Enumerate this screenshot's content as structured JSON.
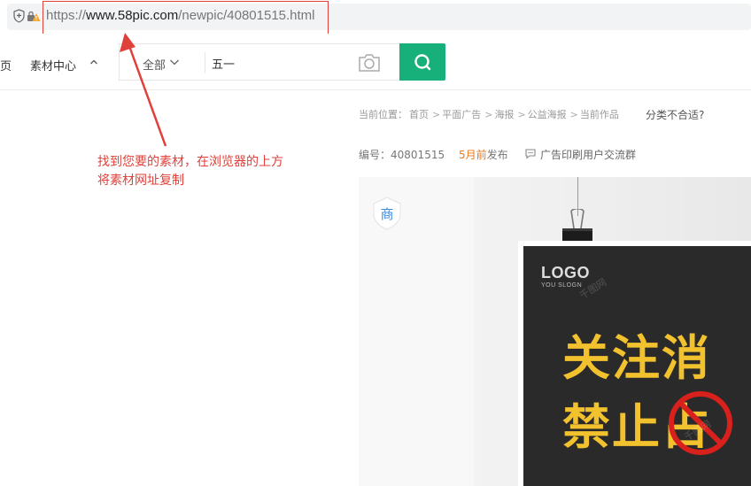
{
  "browser": {
    "url_scheme": "https://",
    "url_host": "www.58pic.com",
    "url_path": "/newpic/40801515.html"
  },
  "header": {
    "nav_fragment": "页",
    "nav_material": "素材中心",
    "search_category": "全部",
    "search_query": "五一"
  },
  "breadcrumb": {
    "prefix": "当前位置：",
    "items": [
      "首页",
      "平面广告",
      "海报",
      "公益海报",
      "当前作品"
    ],
    "separator": ">",
    "question": "分类不合适?"
  },
  "meta": {
    "id_label": "编号：",
    "id_value": "40801515",
    "date_highlight": "5月前",
    "date_suffix": "发布",
    "group_label": "广告印刷用户交流群"
  },
  "annotation": {
    "line1": "找到您要的素材，在浏览器的上方",
    "line2": "将素材网址复制"
  },
  "preview": {
    "badge": "商",
    "poster_logo": "LOGO",
    "poster_slogan": "YOU SLOGN",
    "poster_line1": "关注消",
    "poster_line2": "禁止占",
    "watermark": "千图网"
  },
  "colors": {
    "accent_green": "#17b07a",
    "annotation_red": "#e0403a",
    "date_orange": "#e8791d",
    "poster_yellow": "#f2c12e"
  }
}
